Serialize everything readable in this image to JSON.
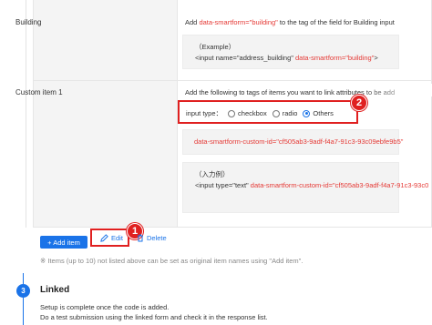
{
  "rows": {
    "building": {
      "label": "Building",
      "instruction_pre": "Add ",
      "instruction_attr": "data-smartform=\"building\"",
      "instruction_post": " to the tag of the field for Building input",
      "example_label": "（Example）",
      "example_pre": "<input name=\"address_building\" ",
      "example_attr": "data-smartform=\"building\"",
      "example_post": ">"
    },
    "custom": {
      "label": "Custom item 1",
      "instruction": "Add the following to tags of items you want to link attributes to be add",
      "input_type_label": "input type：",
      "options": [
        "checkbox",
        "radio",
        "Others"
      ],
      "selected": "Others",
      "attr_code": "data-smartform-custom-id=\"cf505ab3-9adf-f4a7-91c3-93c09ebfe9b5\"",
      "example_label": "（入力例）",
      "example_pre": "<input type=\"text\" ",
      "example_attr": "data-smartform-custom-id=\"cf505ab3-9adf-f4a7-91c3-93c0"
    }
  },
  "actions": {
    "edit": "Edit",
    "delete": "Delete",
    "add_item": "+ Add item"
  },
  "note": "※ Items (up to 10) not listed above can be set as original item names using \"Add item\".",
  "badges": {
    "one": "1",
    "two": "2"
  },
  "step": {
    "number": "3",
    "title": "Linked",
    "line1": "Setup is complete once the code is added.",
    "line2": " Do a test submission using the linked form and check it in the response list."
  },
  "colors": {
    "accent": "#1a73e8",
    "highlight": "#e02020",
    "code_attr": "#e53935"
  }
}
